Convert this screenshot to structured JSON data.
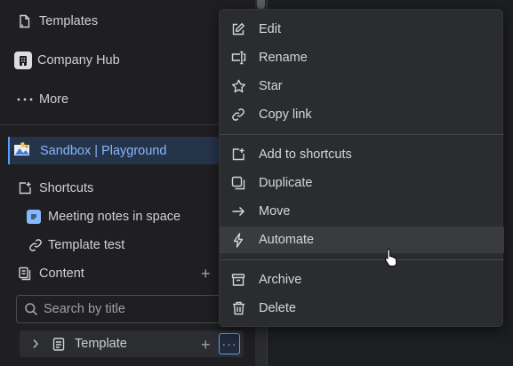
{
  "sidebar": {
    "templates_label": "Templates",
    "company_hub_label": "Company Hub",
    "more_label": "More",
    "space_label": "Sandbox | Playground",
    "shortcuts_label": "Shortcuts",
    "shortcut_items": [
      "Meeting notes in space",
      "Template test"
    ],
    "content_label": "Content",
    "search_placeholder": "Search by title",
    "tree_item_label": "Template",
    "more_actions_glyph": "···"
  },
  "menu": {
    "items": [
      {
        "label": "Edit",
        "icon": "pencil-icon"
      },
      {
        "label": "Rename",
        "icon": "rename-icon"
      },
      {
        "label": "Star",
        "icon": "star-icon"
      },
      {
        "label": "Copy link",
        "icon": "link-icon"
      },
      {
        "label": "Add to shortcuts",
        "icon": "add-shortcut-icon"
      },
      {
        "label": "Duplicate",
        "icon": "duplicate-icon"
      },
      {
        "label": "Move",
        "icon": "arrow-right-icon"
      },
      {
        "label": "Automate",
        "icon": "lightning-icon",
        "hovered": true
      },
      {
        "label": "Archive",
        "icon": "archive-icon"
      },
      {
        "label": "Delete",
        "icon": "trash-icon"
      }
    ]
  },
  "colors": {
    "background": "#1f1f21",
    "menu_bg": "#2b2c2f",
    "accent": "#579dff",
    "selected_bg": "#26344a"
  }
}
